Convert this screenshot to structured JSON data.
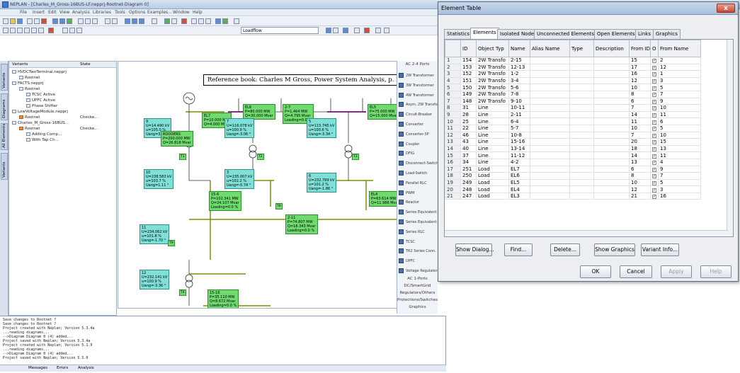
{
  "app": {
    "title": "NEPLAN - [Charles_M_Gross-16BUS-LF.nepprj-Rootnet-Diagram 0]",
    "menu": [
      "File",
      "Insert",
      "Edit",
      "View",
      "Analysis",
      "Libraries",
      "Tools",
      "Options",
      "Examples...",
      "Window",
      "Help"
    ],
    "loadflow_combo": "Loadflow"
  },
  "left_tabs": [
    "Variants",
    "Diagrams",
    "All Elements",
    "Variants"
  ],
  "tree": {
    "col_variants": "Variants",
    "col_state": "State",
    "nodes": [
      {
        "label": "HVDCTwoTerminal.nepprj",
        "state": ""
      },
      {
        "label": "Rootnet",
        "state": ""
      },
      {
        "label": "FACTS.nepprj",
        "state": ""
      },
      {
        "label": "Rootnet",
        "state": ""
      },
      {
        "label": "TCSC Active",
        "state": ""
      },
      {
        "label": "UPFC Active",
        "state": ""
      },
      {
        "label": "Phase Shifter",
        "state": ""
      },
      {
        "label": "LowVoltageModule.nepprj",
        "state": ""
      },
      {
        "label": "Rootnet",
        "state": "Checke..."
      },
      {
        "label": "Charles_M_Gross-16BUS...",
        "state": ""
      },
      {
        "label": "Rootnet",
        "state": "Checke..."
      },
      {
        "label": "Adding Comp...",
        "state": ""
      },
      {
        "label": "With Tap Ch...",
        "state": ""
      }
    ]
  },
  "diagram": {
    "reference": "Reference book: Charles M Gross, Power System Analysis, p. 287",
    "boxes": {
      "b9": [
        "9",
        "U=14.490 kV",
        "u=105.0 %",
        "Uang=3.66 °"
      ],
      "el7": [
        "EL7",
        "P=10.000 MW",
        "Q=4.000 Mvar"
      ],
      "el6": [
        "EL6",
        "P=80.000 MW",
        "Q=30.000 Mvar"
      ],
      "b7": [
        "7",
        "U=116.078 kV",
        "u=100.9 %",
        "Uang=-3.06 °"
      ],
      "el7b": [
        "2-7",
        "P=1.464 MW",
        "Q=4.795 Mvar",
        "Loading=0.0 %"
      ],
      "b5": [
        "5",
        "U=115.745 kV",
        "u=100.6 %",
        "Uang=-3.34 °"
      ],
      "el5": [
        "EL5",
        "P=75.000 MW",
        "Q=15.000 Mvar"
      ],
      "rood": [
        "ROODERS",
        "P=200.000 MW",
        "Q=26.818 Mvar"
      ],
      "b10": [
        "10",
        "U=238.583 kV",
        "u=103.7 %",
        "Uang=1.11 °"
      ],
      "b3": [
        "3",
        "U=235.007 kV",
        "u=102.2 %",
        "Uang=-0.74 °"
      ],
      "b6": [
        "6",
        "U=232.789 kV",
        "u=101.2 %",
        "Uang=-1.86 °"
      ],
      "b11": [
        "11",
        "U=234.062 kV",
        "u=101.8 %",
        "Uang=-1.70 °"
      ],
      "b12": [
        "12",
        "U=232.141 kV",
        "u=100.9 %",
        "Uang=-3.36 °"
      ],
      "f1516": [
        "15-6",
        "P=102.341 MW",
        "Q=24.107 Mvar",
        "Loading=0.0 %"
      ],
      "f211": [
        "2-11",
        "P=74.807 MW",
        "Q=18.343 Mvar",
        "Loading=0.0 %"
      ],
      "el4": [
        "EL4",
        "P=63.614 MW",
        "Q=11.986 Mvar"
      ],
      "f1516b": [
        "15-16",
        "P=35.110 MW",
        "Q=8.672 Mvar",
        "Loading=0.0 %"
      ]
    },
    "small_labels": [
      "T1",
      "T2",
      "T3",
      "T4",
      "T8",
      "T9"
    ]
  },
  "palette": {
    "header": "AC 2-4 Ports",
    "items": [
      "2W Transformer",
      "3W Transformer",
      "4W Transformer",
      "Asym. 2W Transfor",
      "Circuit-Breaker",
      "Converter",
      "Converter-3P",
      "Coupler",
      "DFIG",
      "Disconnect-Switch",
      "Load-Switch",
      "Parallel RLC",
      "PWM",
      "Reactor",
      "Series Equivalent L",
      "Series Equivalent 3",
      "Series RLC",
      "TCSC",
      "TR2 Series Conn.",
      "UPFC",
      "Voltage Regulator"
    ],
    "footer": [
      "AC 1-Ports",
      "DC/SmartGrid",
      "Regulators/Others",
      "Protections/Switches",
      "Graphics"
    ]
  },
  "log": {
    "lines": [
      "Save changes to Rootnet ?",
      "Save changes to Rootnet ?",
      "Project created with Neplan; Version 5.3.4a",
      "...reading diagrams...",
      "-->Diagram Diagram 0 (4) added...",
      "Project saved with Neplan; Version 5.3.4a",
      "Project created with Neplan; Version 5.1.9",
      "...reading diagrams...",
      "-->Diagram Diagram 0 (4) added...",
      "Project saved with Neplan; Version 5.5.0"
    ],
    "tabs": [
      "Messages",
      "Errors",
      "Analysis"
    ]
  },
  "dialog": {
    "title": "Element Table",
    "close": "x",
    "tabs": [
      "Statistics",
      "Elements",
      "Isolated Nodes",
      "Unconnected Elements",
      "Open Elements",
      "Links",
      "Graphics"
    ],
    "active_tab": "Elements",
    "columns": [
      "",
      "ID",
      "Object Typ",
      "Name",
      "Alias Name",
      "Type",
      "Description",
      "From ID",
      "O",
      "From Name"
    ],
    "rows": [
      [
        "1",
        "154",
        "2W Transfo",
        "2-15",
        "",
        "",
        "",
        "15",
        "✓",
        "2"
      ],
      [
        "2",
        "153",
        "2W Transfo",
        "12-13",
        "",
        "",
        "",
        "17",
        "✓",
        "12"
      ],
      [
        "3",
        "152",
        "2W Transfo",
        "1-2",
        "",
        "",
        "",
        "16",
        "✓",
        "1"
      ],
      [
        "4",
        "151",
        "2W Transfo",
        "3-4",
        "",
        "",
        "",
        "12",
        "✓",
        "3"
      ],
      [
        "5",
        "150",
        "2W Transfo",
        "5-6",
        "",
        "",
        "",
        "10",
        "✓",
        "5"
      ],
      [
        "6",
        "149",
        "2W Transfo",
        "7-8",
        "",
        "",
        "",
        "8",
        "✓",
        "7"
      ],
      [
        "7",
        "148",
        "2W Transfo",
        "9-10",
        "",
        "",
        "",
        "6",
        "✓",
        "9"
      ],
      [
        "8",
        "31",
        "Line",
        "10-11",
        "",
        "",
        "",
        "7",
        "✓",
        "10"
      ],
      [
        "9",
        "28",
        "Line",
        "2-11",
        "",
        "",
        "",
        "14",
        "✓",
        "11"
      ],
      [
        "10",
        "25",
        "Line",
        "6-4",
        "",
        "",
        "",
        "11",
        "✓",
        "6"
      ],
      [
        "11",
        "22",
        "Line",
        "5-7",
        "",
        "",
        "",
        "10",
        "✓",
        "5"
      ],
      [
        "12",
        "46",
        "Line",
        "10-8",
        "",
        "",
        "",
        "7",
        "✓",
        "10"
      ],
      [
        "13",
        "43",
        "Line",
        "15-16",
        "",
        "",
        "",
        "20",
        "✓",
        "15"
      ],
      [
        "14",
        "40",
        "Line",
        "13-14",
        "",
        "",
        "",
        "18",
        "✓",
        "13"
      ],
      [
        "15",
        "37",
        "Line",
        "11-12",
        "",
        "",
        "",
        "14",
        "✓",
        "11"
      ],
      [
        "16",
        "34",
        "Line",
        "4-2",
        "",
        "",
        "",
        "13",
        "✓",
        "4"
      ],
      [
        "17",
        "251",
        "Load",
        "EL7",
        "",
        "",
        "",
        "6",
        "✓",
        "9"
      ],
      [
        "18",
        "250",
        "Load",
        "EL6",
        "",
        "",
        "",
        "8",
        "✓",
        "7"
      ],
      [
        "19",
        "249",
        "Load",
        "EL5",
        "",
        "",
        "",
        "10",
        "✓",
        "5"
      ],
      [
        "20",
        "248",
        "Load",
        "EL4",
        "",
        "",
        "",
        "12",
        "✓",
        "3"
      ],
      [
        "21",
        "247",
        "Load",
        "EL3",
        "",
        "",
        "",
        "21",
        "✓",
        "16"
      ]
    ],
    "buttons": [
      "Show Dialog...",
      "Find...",
      "Delete...",
      "Show Graphics",
      "Variant Info..."
    ],
    "footer_buttons": [
      "OK",
      "Cancel",
      "Apply",
      "Help"
    ]
  }
}
